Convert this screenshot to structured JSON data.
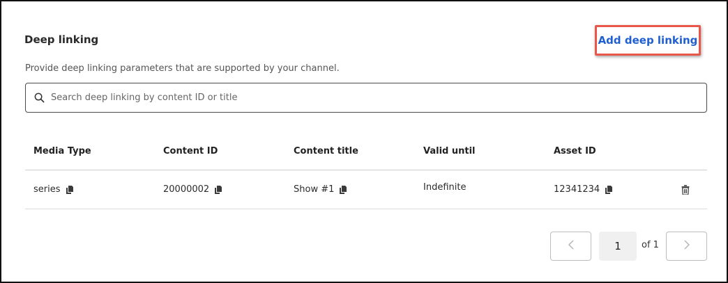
{
  "section": {
    "title": "Deep linking",
    "description": "Provide deep linking parameters that are supported by your channel.",
    "add_button_label": "Add deep linking"
  },
  "search": {
    "placeholder": "Search deep linking by content ID or title",
    "value": ""
  },
  "table": {
    "headers": [
      "Media Type",
      "Content ID",
      "Content title",
      "Valid until",
      "Asset ID"
    ],
    "rows": [
      {
        "media_type": "series",
        "content_id": "20000002",
        "content_title": "Show #1",
        "valid_until": "Indefinite",
        "asset_id": "12341234"
      }
    ]
  },
  "pagination": {
    "current_page": "1",
    "of_label": "of 1"
  },
  "icons": {
    "search": "search-icon",
    "copy": "copy-icon",
    "delete": "trash-icon",
    "prev": "chevron-left-icon",
    "next": "chevron-right-icon"
  },
  "colors": {
    "link": "#1f5fd1",
    "highlight_border": "#e8574a"
  }
}
